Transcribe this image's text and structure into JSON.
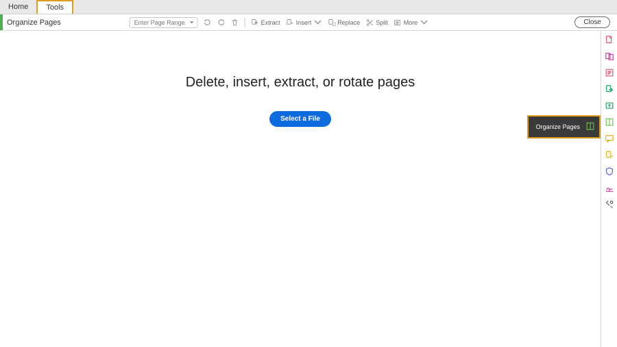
{
  "tabs": {
    "home": "Home",
    "tools": "Tools"
  },
  "subbar": {
    "title": "Organize Pages",
    "page_range": "Enter Page Range",
    "extract": "Extract",
    "insert": "Insert",
    "replace": "Replace",
    "split": "Split",
    "more": "More",
    "close": "Close"
  },
  "main": {
    "headline": "Delete, insert, extract, or rotate pages",
    "select_file": "Select a File"
  },
  "tooltip": {
    "label": "Organize Pages"
  }
}
